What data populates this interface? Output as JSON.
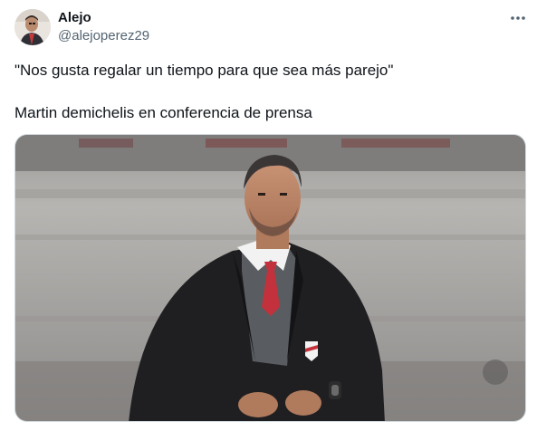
{
  "author": {
    "name": "Alejo",
    "handle": "@alejoperez29",
    "avatar_icon": "user-avatar"
  },
  "menu": {
    "more_icon": "more-horizontal-icon"
  },
  "tweet": {
    "text_line1": "\"Nos gusta regalar un tiempo para que sea más parejo\"",
    "text_line2": "Martin demichelis en conferencia de prensa"
  },
  "media": {
    "kind": "photo",
    "subject": "man in dark suit with red tie in stadium"
  },
  "colors": {
    "text": "#0f1419",
    "secondary_text": "#536471",
    "border": "#cfd9de"
  }
}
